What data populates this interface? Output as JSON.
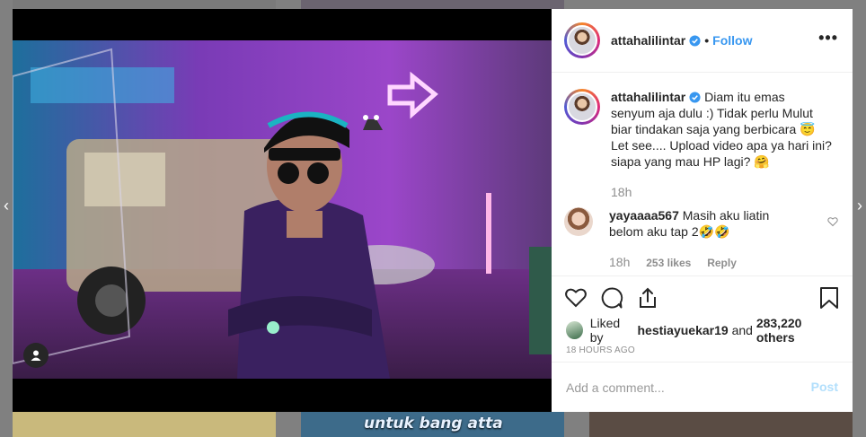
{
  "background": {
    "caption": "untuk bang atta"
  },
  "post": {
    "username": "attahalilintar",
    "follow_label": "Follow",
    "separator": "•",
    "more_label": "•••",
    "caption_username": "attahalilintar",
    "caption_lines": [
      "Diam itu emas",
      "senyum aja dulu :) Tidak perlu Mulut",
      "biar tindakan saja yang berbicara 😇",
      "Let see.... Upload video apa ya hari ini?",
      "siapa yang mau HP lagi? 🤗"
    ],
    "caption_age": "18h"
  },
  "comments": [
    {
      "username": "yayaaaa567",
      "text_line1": "Masih aku liatin",
      "text_line2": "belom aku tap 2🤣🤣",
      "age": "18h",
      "likes": "253 likes",
      "reply": "Reply"
    }
  ],
  "likes": {
    "prefix": "Liked by",
    "user": "hestiayuekar19",
    "middle": "and",
    "others": "283,220 others"
  },
  "timestamp": "18 HOURS AGO",
  "add_comment": {
    "placeholder": "Add a comment...",
    "post_label": "Post"
  },
  "colors": {
    "accent": "#3897f0",
    "post_disabled": "#b2dffc",
    "muted": "#8e8e8e",
    "verified": "#3897f0"
  },
  "icons": {
    "heart": "heart-icon",
    "comment": "comment-icon",
    "share": "share-icon",
    "bookmark": "bookmark-icon",
    "verified": "verified-badge-icon",
    "user_tag": "user-tag-icon"
  }
}
